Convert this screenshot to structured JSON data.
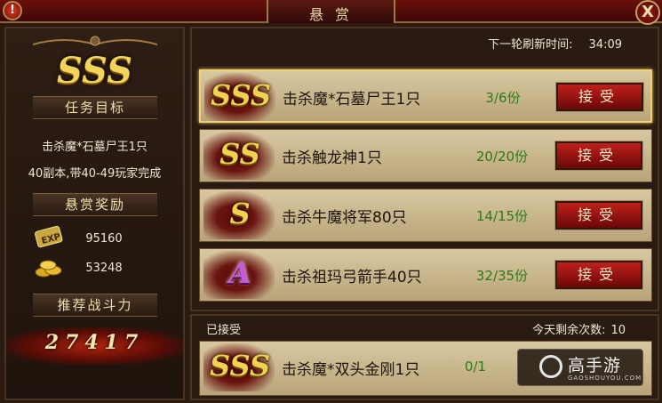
{
  "window": {
    "title": "悬 赏",
    "alert_icon": "!",
    "close_icon": "X"
  },
  "left_panel": {
    "target_grade": "SSS",
    "section_target": "任务目标",
    "target_desc": "击杀魔*石墓尸王1只",
    "target_detail": "40副本,带40-49玩家完成",
    "section_reward": "悬赏奖励",
    "rewards": [
      {
        "icon": "exp-icon",
        "icon_text": "EXP",
        "value": "95160"
      },
      {
        "icon": "gold-coins-icon",
        "value": "53248"
      }
    ],
    "section_power": "推荐战斗力",
    "recommended_power": "27417"
  },
  "task_board": {
    "refresh_label": "下一轮刷新时间:",
    "refresh_time": "34:09",
    "tasks": [
      {
        "grade": "SSS",
        "name": "击杀魔*石墓尸王1只",
        "count": "3/6份",
        "button": "接受",
        "selected": true
      },
      {
        "grade": "SS",
        "name": "击杀触龙神1只",
        "count": "20/20份",
        "button": "接受",
        "selected": false
      },
      {
        "grade": "S",
        "name": "击杀牛魔将军80只",
        "count": "14/15份",
        "button": "接受",
        "selected": false
      },
      {
        "grade": "A",
        "name": "击杀祖玛弓箭手40只",
        "count": "32/35份",
        "button": "接受",
        "selected": false
      }
    ]
  },
  "accepted": {
    "label": "已接受",
    "remaining_label": "今天剩余次数:",
    "remaining_value": "10",
    "task": {
      "grade": "SSS",
      "name": "击杀魔*双头金刚1只",
      "count": "0/1"
    }
  },
  "watermark": {
    "text": "高手游",
    "sub": "GAOSHOUYOU.COM"
  },
  "colors": {
    "accent_gold": "#f1d24e",
    "count_green": "#2c7a1a",
    "button_red": "#c0201a"
  }
}
